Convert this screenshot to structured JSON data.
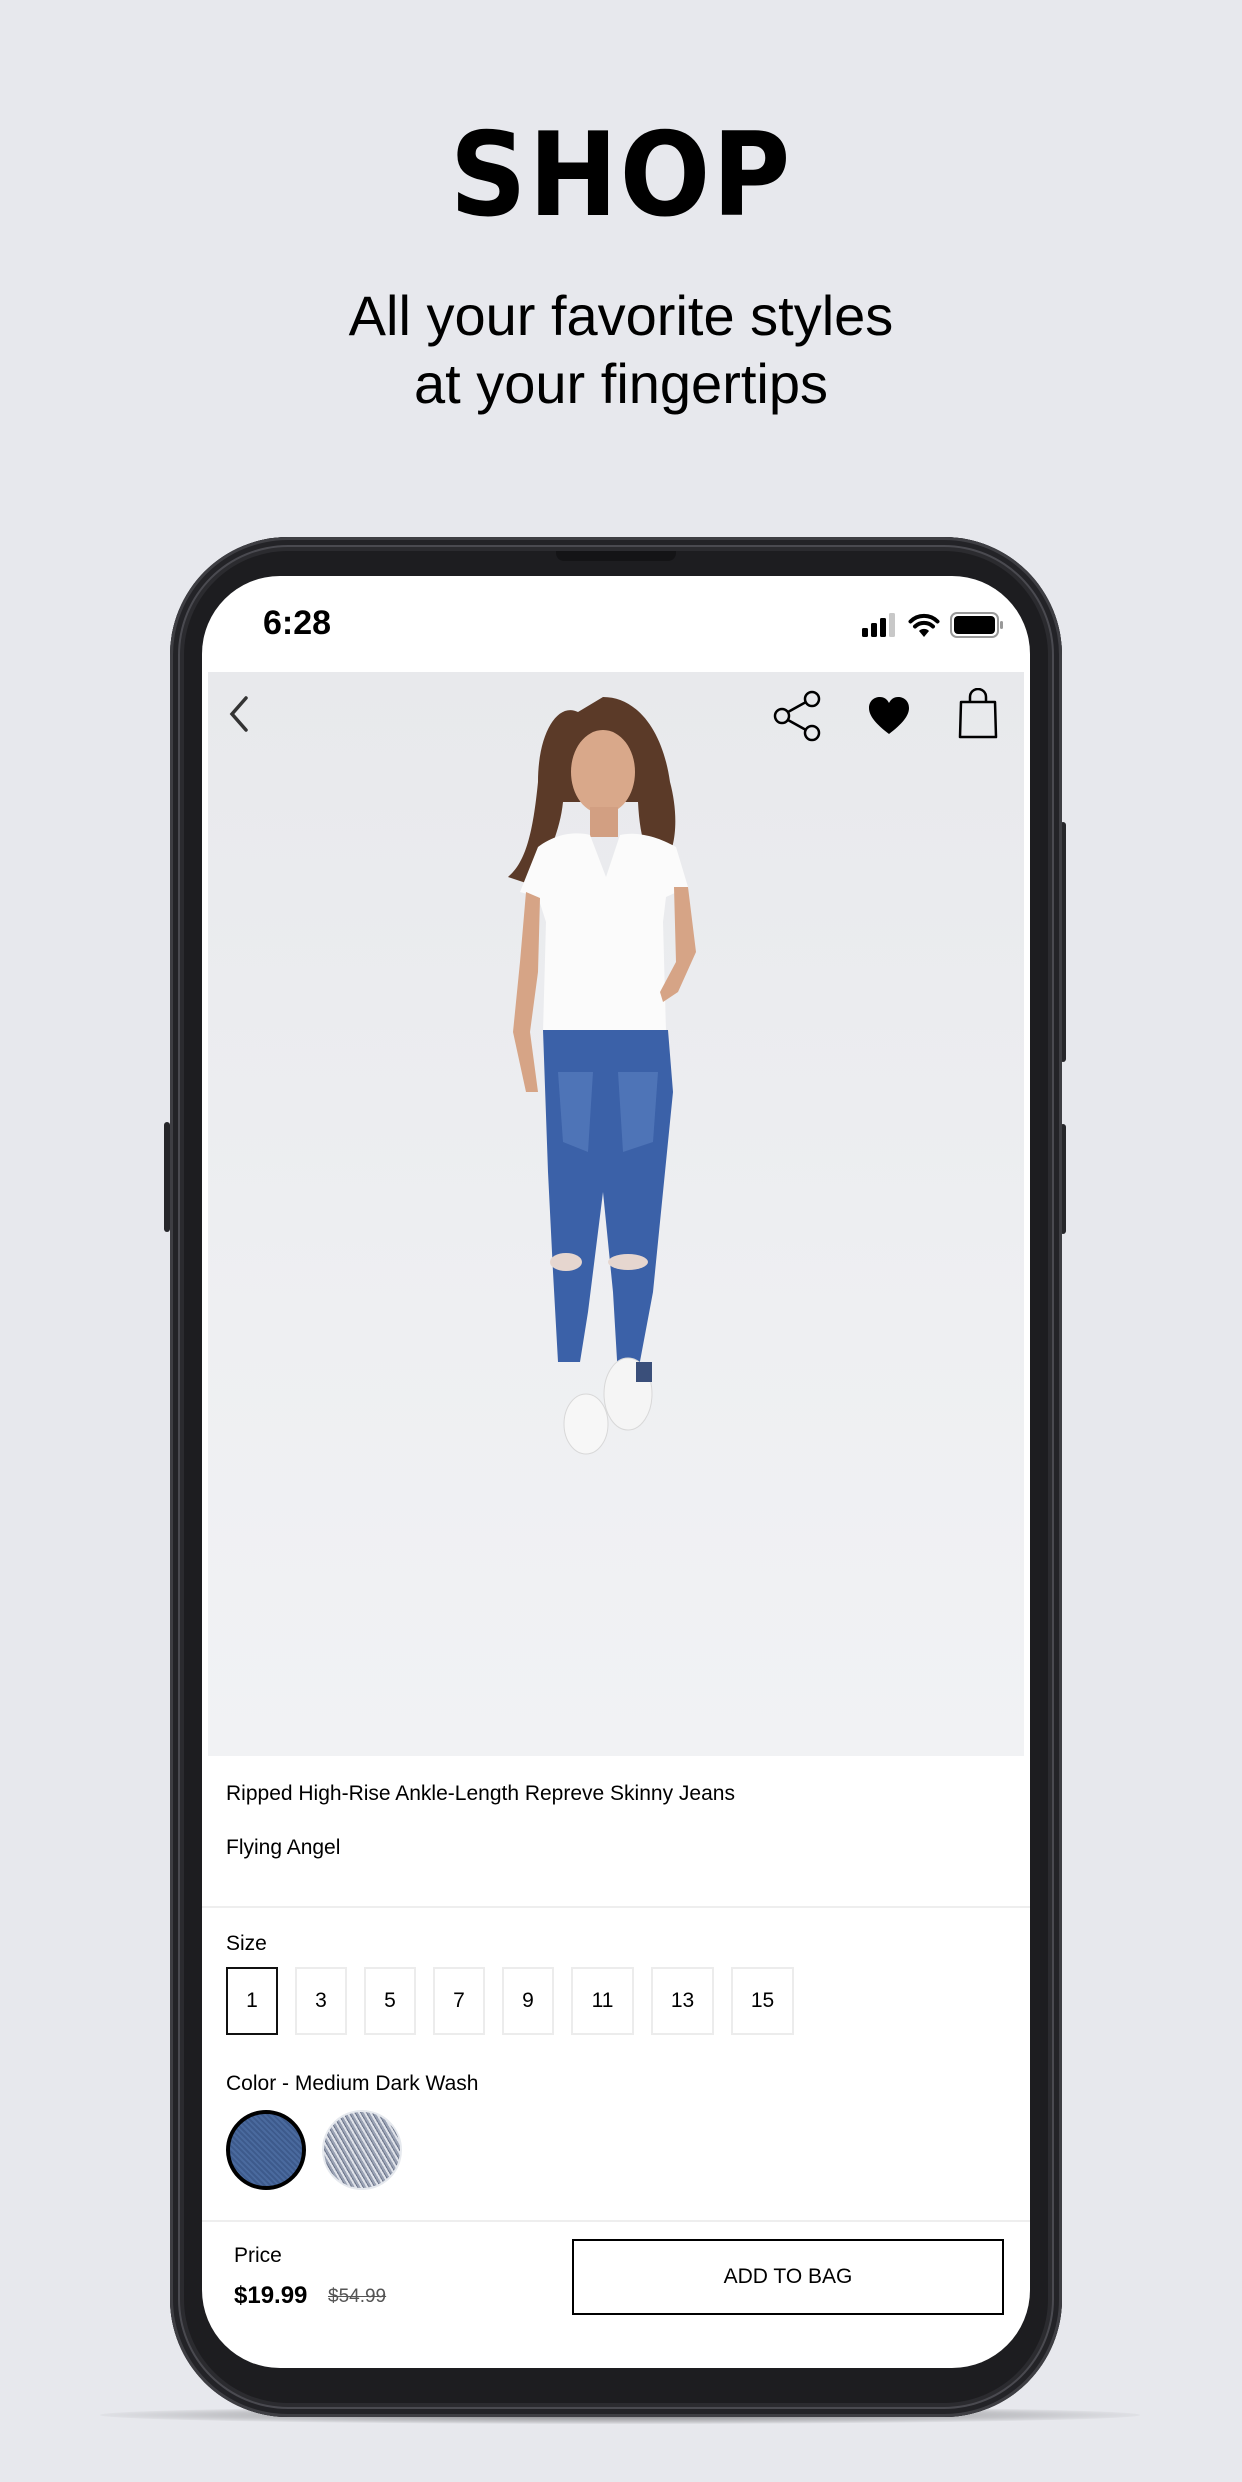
{
  "hero": {
    "title": "SHOP",
    "subtitle_line1": "All your favorite styles",
    "subtitle_line2": "at your fingertips"
  },
  "status_bar": {
    "time": "6:28",
    "icons": [
      "cellular-signal-icon",
      "wifi-icon",
      "battery-icon"
    ]
  },
  "photo_toolbar": {
    "icons": [
      "back-chevron-icon",
      "share-icon",
      "heart-icon",
      "shopping-bag-icon"
    ]
  },
  "product": {
    "name": "Ripped High-Rise Ankle-Length Repreve Skinny Jeans",
    "brand": "Flying Angel"
  },
  "size": {
    "label": "Size",
    "options": [
      "1",
      "3",
      "5",
      "7",
      "9",
      "11",
      "13",
      "15"
    ],
    "selected": "1"
  },
  "color": {
    "label": "Color - Medium Dark Wash",
    "swatches": [
      {
        "name": "Medium Dark Wash",
        "color": "#3f5a8a",
        "selected": true
      },
      {
        "name": "Light Wash",
        "color": "#b9bfcb",
        "selected": false
      }
    ]
  },
  "footer": {
    "price_label": "Price",
    "price": "$19.99",
    "original_price": "$54.99",
    "add_to_bag_label": "ADD TO BAG"
  },
  "colors": {
    "background": "#e7e8ed",
    "phone_frame": "#2b2b2f",
    "text": "#000000"
  }
}
